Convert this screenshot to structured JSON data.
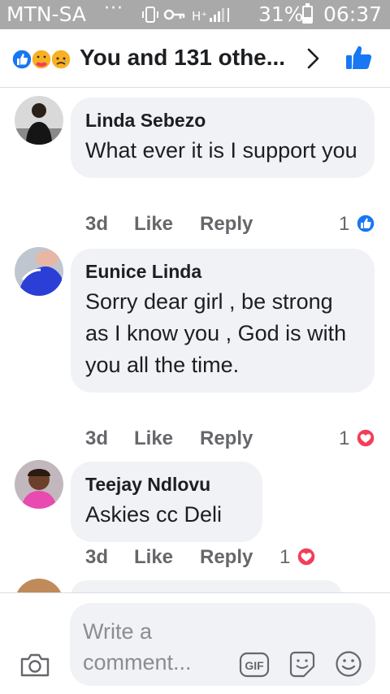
{
  "status_bar": {
    "carrier": "MTN-SA",
    "dots": "···",
    "battery_percent": "31%",
    "time": "06:37"
  },
  "header": {
    "title": "You and 131 othe...",
    "reaction_icons": [
      "like-icon",
      "care-icon",
      "sad-icon"
    ],
    "chevron_icon": "chevron-right-icon",
    "like_icon": "thumbs-up-icon",
    "accent_color": "#1877f2"
  },
  "comments": [
    {
      "name": "Linda Sebezo",
      "text": "What ever it is I support you",
      "time": "3d",
      "like_label": "Like",
      "reply_label": "Reply",
      "reaction_count": "1",
      "reaction_icon": "like-icon"
    },
    {
      "name": "Eunice Linda",
      "text": "Sorry dear girl , be strong as I know you , God is with you all the time.",
      "time": "3d",
      "like_label": "Like",
      "reply_label": "Reply",
      "reaction_count": "1",
      "reaction_icon": "love-icon"
    },
    {
      "name": "Teejay Ndlovu",
      "text": "Askies cc Deli",
      "time": "3d",
      "like_label": "Like",
      "reply_label": "Reply",
      "reaction_count": "1",
      "reaction_icon": "love-icon"
    }
  ],
  "composer": {
    "placeholder": "Write a comment...",
    "camera_icon": "camera-icon",
    "gif_label": "GIF",
    "sticker_icon": "sticker-icon",
    "emoji_icon": "emoji-icon"
  },
  "colors": {
    "like_blue": "#1877f2",
    "love_red": "#f33e58",
    "bubble_bg": "#f0f2f5",
    "meta_gray": "#65676b"
  }
}
